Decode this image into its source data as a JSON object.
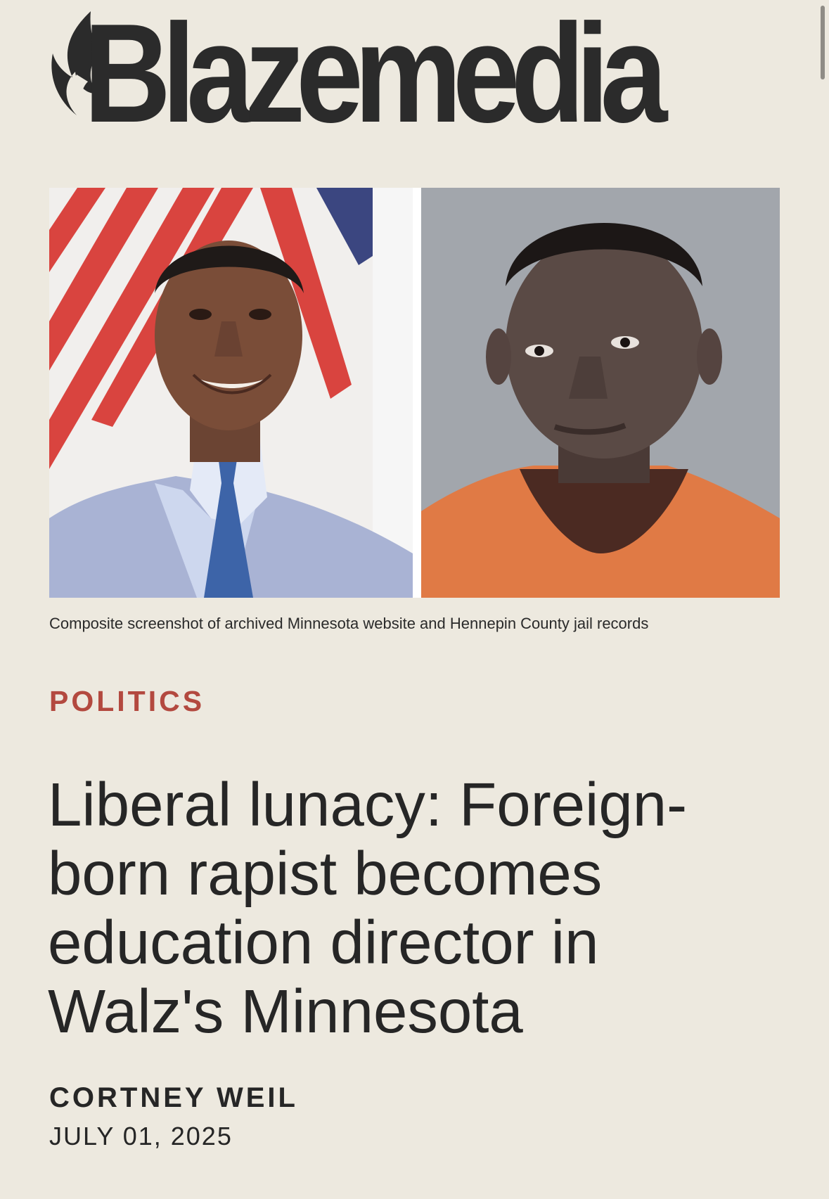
{
  "brand": {
    "logo_text": "Blazemedia",
    "color": "#2b2b2b"
  },
  "hero": {
    "left_photo_icon": "politician-portrait-photo",
    "right_photo_icon": "jail-booking-photo",
    "caption": "Composite screenshot of archived Minnesota website and Hennepin County jail records"
  },
  "article": {
    "section": "POLITICS",
    "section_color": "#b3493f",
    "headline": "Liberal lunacy: Foreign-born rapist becomes education director in Walz's Minnesota",
    "author": "CORTNEY WEIL",
    "date": "JULY 01, 2025"
  },
  "theme": {
    "background": "#ede9df",
    "text": "#262626"
  }
}
